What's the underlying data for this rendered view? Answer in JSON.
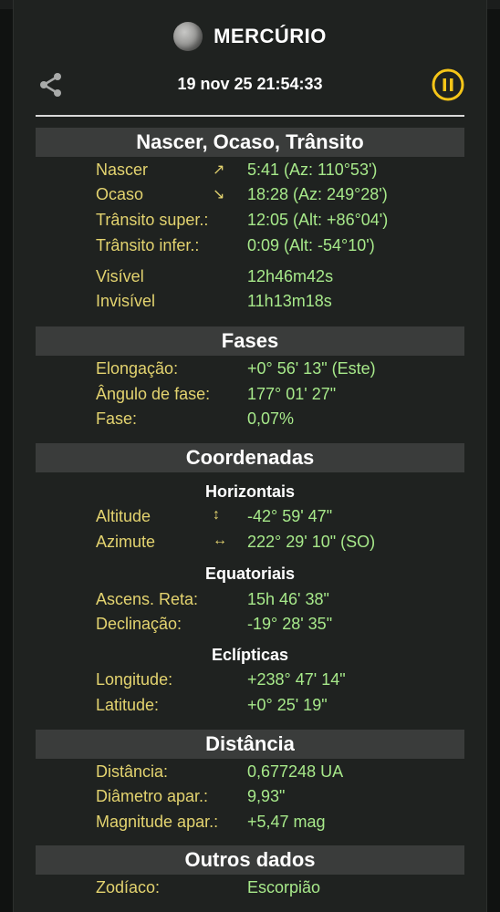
{
  "header": {
    "title": "MERCÚRIO",
    "datetime": "19 nov 25  21:54:33"
  },
  "sections": {
    "rise_set": {
      "title": "Nascer, Ocaso, Trânsito",
      "rows": [
        {
          "label": "Nascer",
          "arrow": "↗",
          "value": "5:41 (Az: 110°53')"
        },
        {
          "label": "Ocaso",
          "arrow": "↘",
          "value": "18:28 (Az: 249°28')"
        },
        {
          "label": "Trânsito super.:",
          "value": "12:05 (Alt: +86°04')"
        },
        {
          "label": "Trânsito infer.:",
          "value": "0:09 (Alt: -54°10')"
        },
        {
          "label": "Visível",
          "value": "12h46m42s"
        },
        {
          "label": "Invisível",
          "value": "11h13m18s"
        }
      ]
    },
    "phases": {
      "title": "Fases",
      "rows": [
        {
          "label": "Elongação:",
          "value": "+0° 56' 13\" (Este)"
        },
        {
          "label": "Ângulo de fase:",
          "value": "177° 01' 27\""
        },
        {
          "label": "Fase:",
          "value": "0,07%"
        }
      ]
    },
    "coordinates": {
      "title": "Coordenadas",
      "horizontal_title": "Horizontais",
      "horizontal": [
        {
          "label": "Altitude",
          "arrow": "↕",
          "value": "-42° 59' 47\""
        },
        {
          "label": "Azimute",
          "arrow": "↔",
          "value": "222° 29' 10\" (SO)"
        }
      ],
      "equatorial_title": "Equatoriais",
      "equatorial": [
        {
          "label": "Ascens. Reta:",
          "value": "15h 46' 38\""
        },
        {
          "label": "Declinação:",
          "value": "-19° 28' 35\""
        }
      ],
      "ecliptic_title": "Eclípticas",
      "ecliptic": [
        {
          "label": "Longitude:",
          "value": "+238° 47' 14\""
        },
        {
          "label": "Latitude:",
          "value": "+0° 25' 19\""
        }
      ]
    },
    "distance": {
      "title": "Distância",
      "rows": [
        {
          "label": "Distância:",
          "value": "0,677248 UA"
        },
        {
          "label": "Diâmetro apar.:",
          "value": "9,93\""
        },
        {
          "label": "Magnitude apar.:",
          "value": "+5,47 mag"
        }
      ]
    },
    "other": {
      "title": "Outros dados",
      "rows": [
        {
          "label": "Zodíaco:",
          "value": "Escorpião"
        }
      ]
    }
  },
  "colors": {
    "label": "#e3d36f",
    "value": "#a7e98a",
    "accent": "#f5c518",
    "section_bg": "#3a3c3b"
  },
  "icons": {
    "share": "share-icon",
    "pause": "pause-icon",
    "planet": "planet-icon"
  }
}
